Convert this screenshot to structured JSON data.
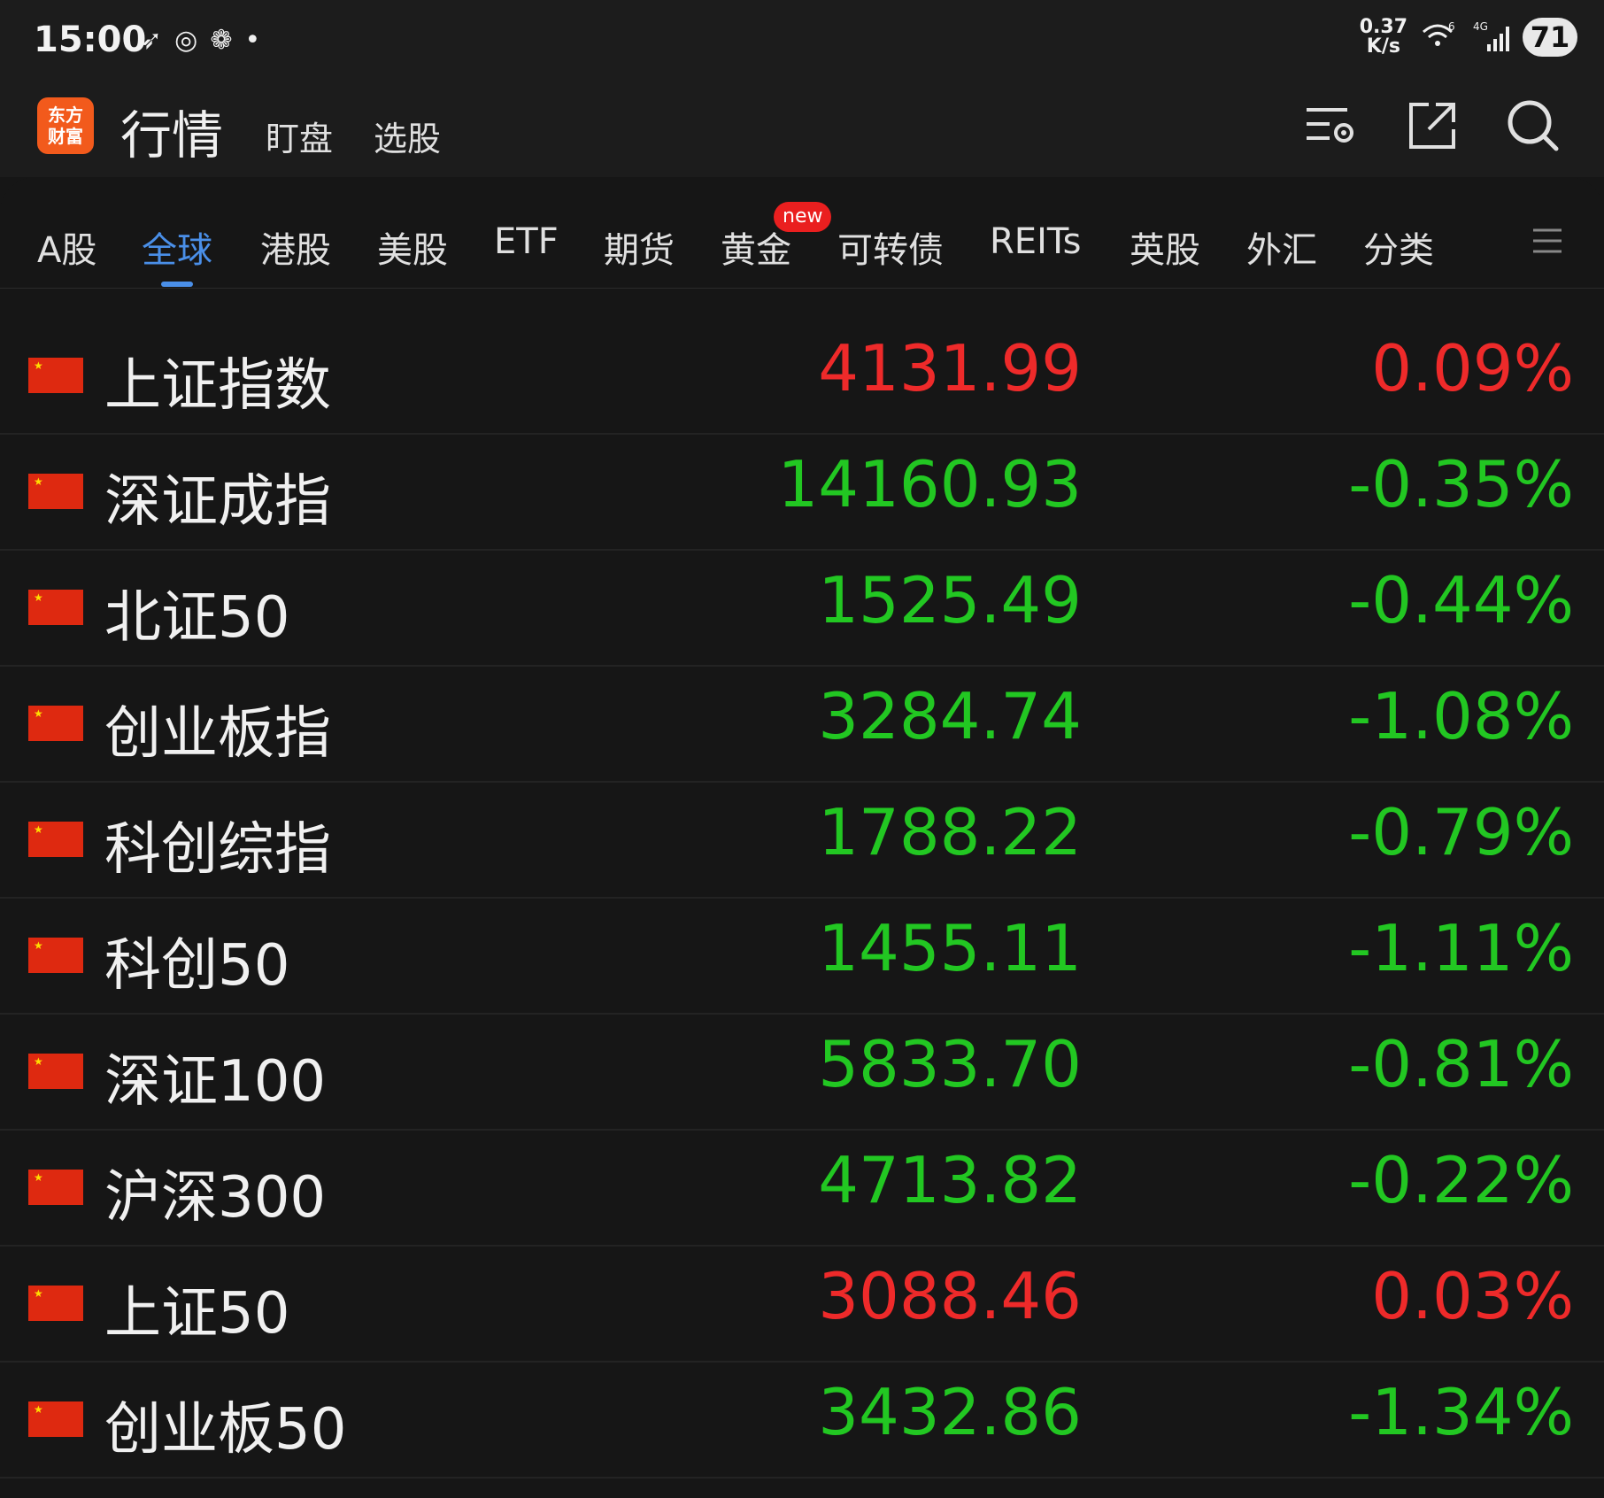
{
  "status_bar": {
    "time": "15:00",
    "app_icons": [
      "feather-app-icon",
      "weibo-icon",
      "wechat-icon"
    ],
    "dot": "•",
    "net_speed_value": "0.37",
    "net_speed_unit": "K/s",
    "wifi_label": "6",
    "cell_label": "4G",
    "battery": "71"
  },
  "header": {
    "logo_line1": "东方",
    "logo_line2": "财富",
    "title": "行情",
    "sub_tabs": [
      "盯盘",
      "选股"
    ],
    "icons": [
      "list-settings-icon",
      "external-link-icon",
      "search-icon"
    ]
  },
  "tabs": {
    "items": [
      "A股",
      "全球",
      "港股",
      "美股",
      "ETF",
      "期货",
      "黄金",
      "可转债",
      "REITs",
      "英股",
      "外汇",
      "分类"
    ],
    "active": "全球",
    "badge": "new"
  },
  "colors": {
    "up": "#ee2a2a",
    "down": "#22c722",
    "accent": "#4a8fe8",
    "background": "#161616"
  },
  "rows": [
    {
      "name": "上证指数",
      "price": "4131.99",
      "change": "0.09%",
      "direction": "up"
    },
    {
      "name": "深证成指",
      "price": "14160.93",
      "change": "-0.35%",
      "direction": "down"
    },
    {
      "name": "北证50",
      "price": "1525.49",
      "change": "-0.44%",
      "direction": "down"
    },
    {
      "name": "创业板指",
      "price": "3284.74",
      "change": "-1.08%",
      "direction": "down"
    },
    {
      "name": "科创综指",
      "price": "1788.22",
      "change": "-0.79%",
      "direction": "down"
    },
    {
      "name": "科创50",
      "price": "1455.11",
      "change": "-1.11%",
      "direction": "down"
    },
    {
      "name": "深证100",
      "price": "5833.70",
      "change": "-0.81%",
      "direction": "down"
    },
    {
      "name": "沪深300",
      "price": "4713.82",
      "change": "-0.22%",
      "direction": "down"
    },
    {
      "name": "上证50",
      "price": "3088.46",
      "change": "0.03%",
      "direction": "up"
    },
    {
      "name": "创业板50",
      "price": "3432.86",
      "change": "-1.34%",
      "direction": "down"
    }
  ]
}
